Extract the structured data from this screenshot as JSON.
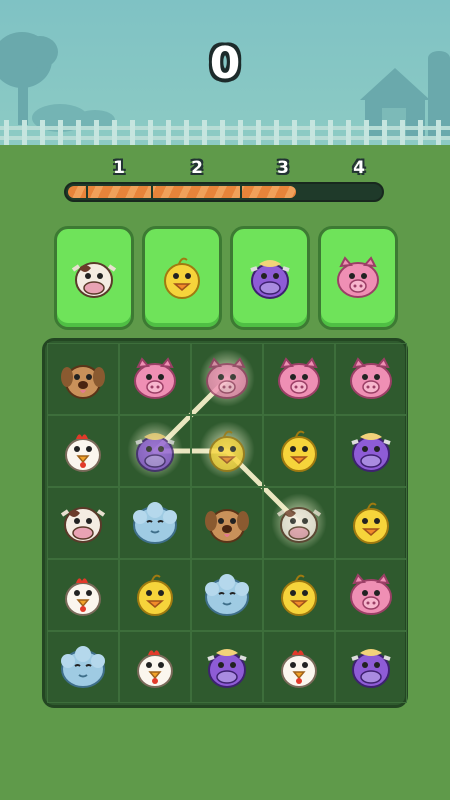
{
  "score": "0",
  "progress": {
    "labels": [
      "1",
      "2",
      "3",
      "4"
    ],
    "fill_fraction": 0.73,
    "fill_color": "#e7843a"
  },
  "targets": [
    {
      "animal": "cow"
    },
    {
      "animal": "chick"
    },
    {
      "animal": "bull"
    },
    {
      "animal": "pig"
    }
  ],
  "board": {
    "rows": [
      [
        "dog",
        "pig",
        "pig",
        "pig",
        "pig"
      ],
      [
        "chicken",
        "bull",
        "chick",
        "chick",
        "bull"
      ],
      [
        "cow",
        "sheep",
        "dog",
        "cow",
        "chick"
      ],
      [
        "chicken",
        "chick",
        "sheep",
        "chick",
        "pig"
      ],
      [
        "sheep",
        "chicken",
        "bull",
        "chicken",
        "bull"
      ]
    ],
    "selected_chain": [
      [
        0,
        2
      ],
      [
        1,
        1
      ],
      [
        1,
        2
      ],
      [
        2,
        3
      ]
    ]
  },
  "colors": {
    "sky": "#7fc2c4",
    "grass": "#5f9a4a",
    "board": "#2f5a2e",
    "target_slot": "#6fe35a"
  },
  "icons": {
    "pig": "pig-face-icon",
    "chick": "chick-face-icon",
    "cow": "cow-face-icon",
    "bull": "purple-bull-face-icon",
    "dog": "dog-face-icon",
    "chicken": "chicken-face-icon",
    "sheep": "sheep-face-icon"
  }
}
